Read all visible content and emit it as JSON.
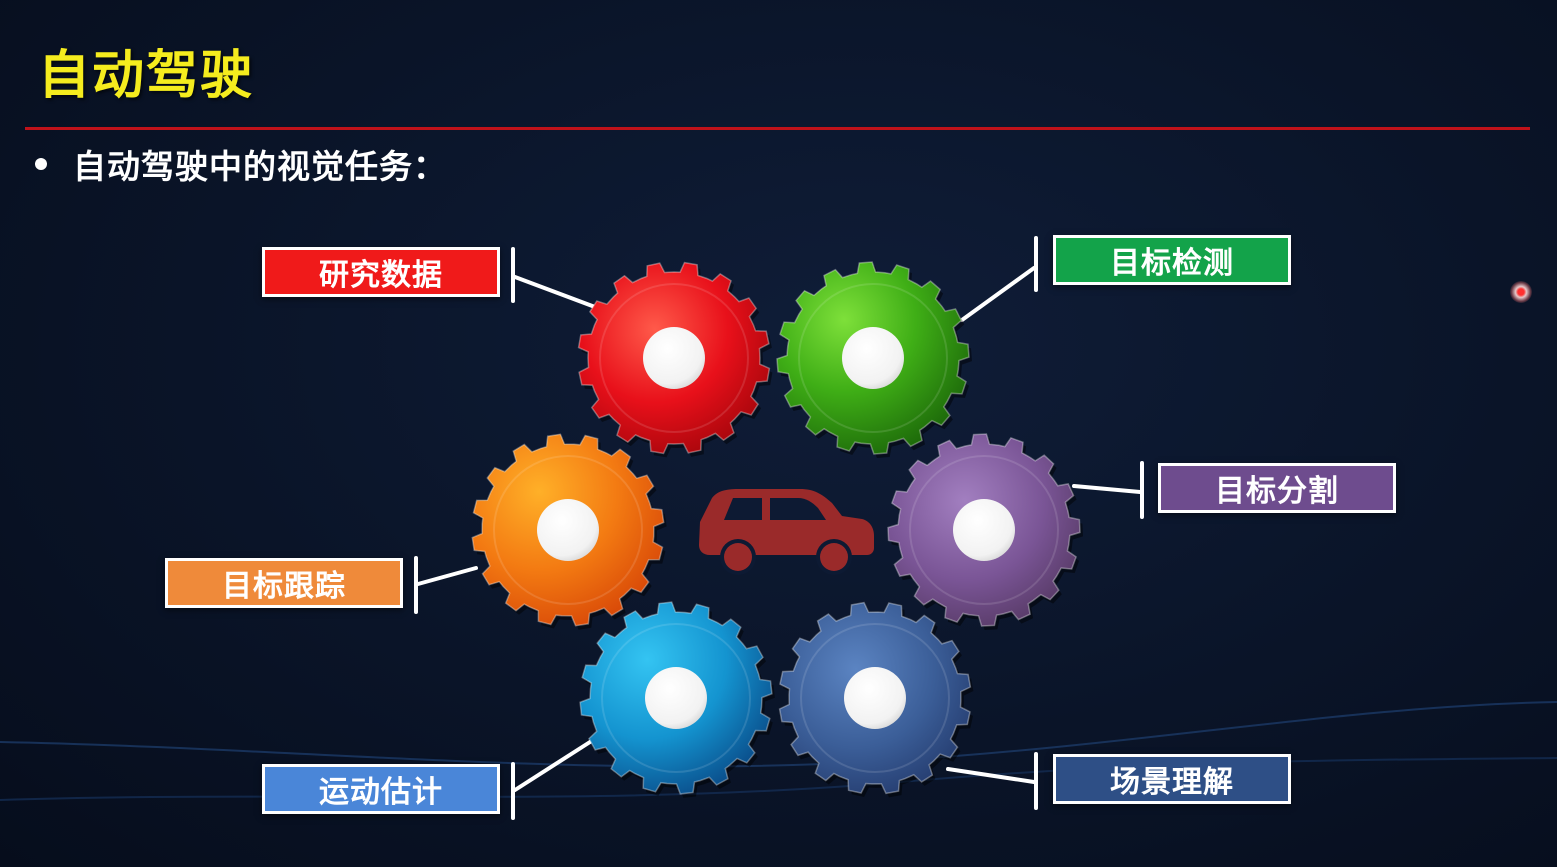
{
  "slide": {
    "title": "自动驾驶",
    "bullet": "自动驾驶中的视觉任务："
  },
  "labels": {
    "research_data": "研究数据",
    "object_detection": "目标检测",
    "object_segmentation": "目标分割",
    "object_tracking": "目标跟踪",
    "motion_estimation": "运动估计",
    "scene_understanding": "场景理解"
  },
  "colors": {
    "title": "#f5ec1e",
    "rule": "#c0121a",
    "research_data": "#f01a1a",
    "object_detection": "#13a34a",
    "object_segmentation": "#6e4c8e",
    "object_tracking": "#ef8a3a",
    "motion_estimation": "#4a86d8",
    "scene_understanding": "#2e4f86",
    "car": "#9a2a2a"
  },
  "icons": {
    "center": "car-icon",
    "gears": [
      "red-gear-icon",
      "green-gear-icon",
      "orange-gear-icon",
      "purple-gear-icon",
      "blue-gear-icon",
      "navy-gear-icon"
    ]
  }
}
